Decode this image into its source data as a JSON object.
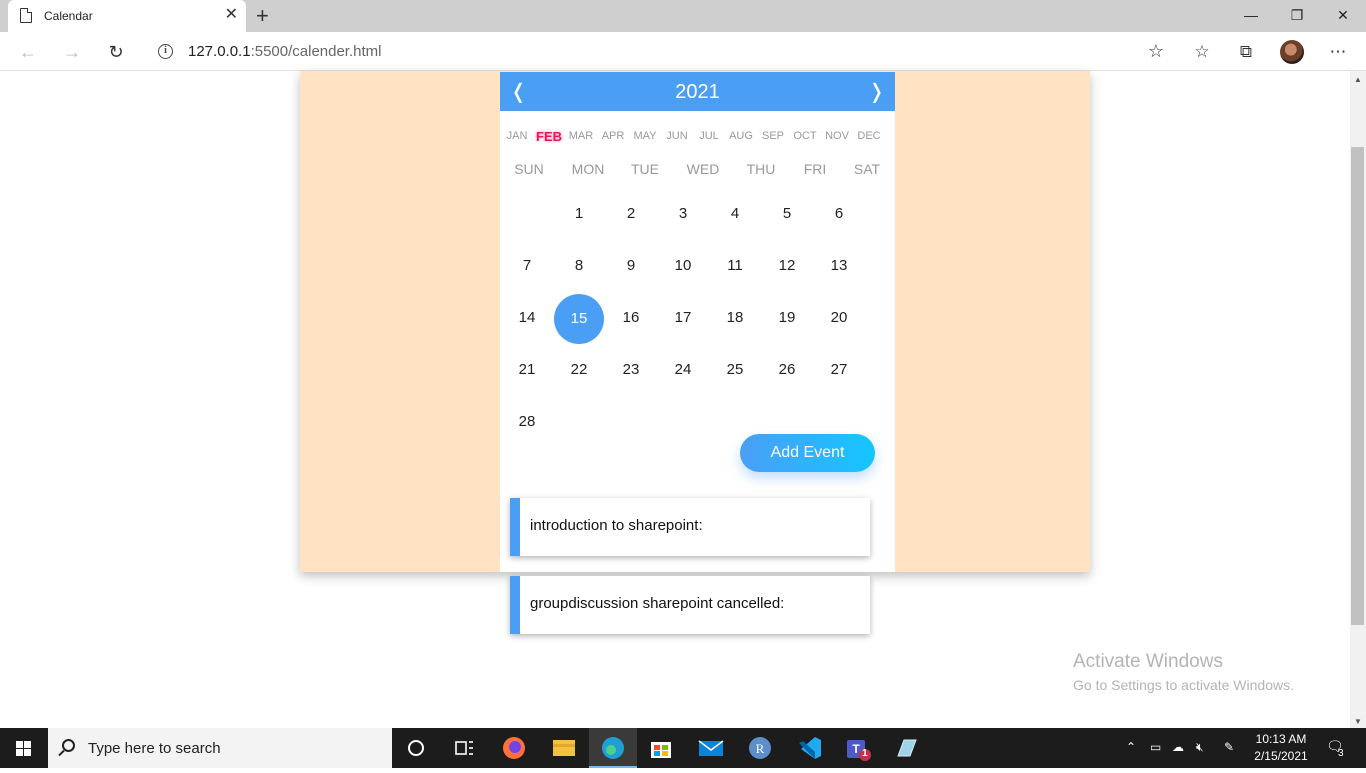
{
  "browser": {
    "tab_title": "Calendar",
    "new_tab": "+",
    "tab_close": "✕",
    "url_host": "127.0.0.1",
    "url_rest": ":5500/calender.html",
    "win_min": "—",
    "win_restore": "❐",
    "win_close": "✕"
  },
  "calendar": {
    "year": "2021",
    "prev": "❬",
    "next": "❭",
    "months": [
      "JAN",
      "FEB",
      "MAR",
      "APR",
      "MAY",
      "JUN",
      "JUL",
      "AUG",
      "SEP",
      "OCT",
      "NOV",
      "DEC"
    ],
    "current_month": "FEB",
    "weekdays": [
      "SUN",
      "MON",
      "TUE",
      "WED",
      "THU",
      "FRI",
      "SAT"
    ],
    "first_weekday_index": 1,
    "days_in_month": 28,
    "today": 15,
    "accent_color": "#4a9ff5",
    "month_highlight_color": "#e8175d"
  },
  "actions": {
    "add_event": "Add Event"
  },
  "events": [
    {
      "text": "introduction to sharepoint:"
    },
    {
      "text": "groupdiscussion sharepoint cancelled:"
    }
  ],
  "watermark": {
    "line1": "Activate Windows",
    "line2": "Go to Settings to activate Windows."
  },
  "taskbar": {
    "search_placeholder": "Type here to search",
    "time": "10:13 AM",
    "date": "2/15/2021",
    "notification_count": "3",
    "teams_badge": "1"
  },
  "icons": [
    "back-arrow-icon",
    "forward-arrow-icon",
    "refresh-icon",
    "info-icon",
    "add-favorite-icon",
    "favorites-icon",
    "collections-icon",
    "more-icon",
    "windows-start-icon",
    "search-icon",
    "task-view-icon",
    "firefox-icon",
    "file-explorer-icon",
    "edge-icon",
    "store-icon",
    "mail-icon",
    "r-app-icon",
    "vscode-icon",
    "teams-icon",
    "notepad-icon"
  ]
}
